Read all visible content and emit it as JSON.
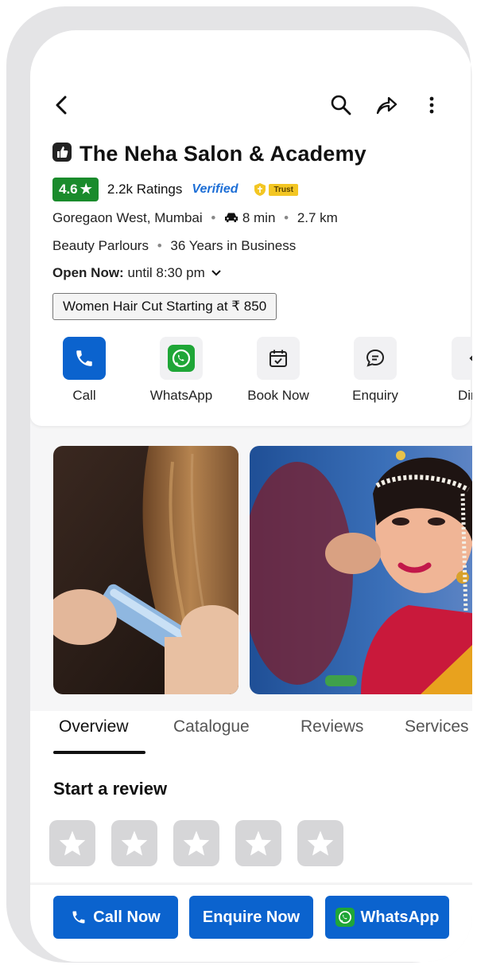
{
  "header": {
    "icons": [
      "back-arrow-icon",
      "search-icon",
      "share-icon",
      "more-vertical-icon"
    ]
  },
  "business": {
    "name": "The Neha Salon & Academy",
    "rating": "4.6",
    "rating_star": "★",
    "ratings_count": "2.2k Ratings",
    "verified_label": "Verified",
    "trust_label": "Trust",
    "location": "Goregaon West, Mumbai",
    "drive_time": "8 min",
    "distance": "2.7 km",
    "category": "Beauty Parlours",
    "years_in_business": "36 Years in Business",
    "open_label": "Open Now:",
    "open_until": "until 8:30 pm",
    "offer": "Women Hair Cut Starting at ₹ 850"
  },
  "actions": [
    {
      "label": "Call",
      "icon": "phone-icon"
    },
    {
      "label": "WhatsApp",
      "icon": "whatsapp-icon"
    },
    {
      "label": "Book Now",
      "icon": "calendar-check-icon"
    },
    {
      "label": "Enquiry",
      "icon": "chat-bubble-icon"
    },
    {
      "label": "Dire",
      "icon": "directions-icon"
    }
  ],
  "tabs": [
    {
      "label": "Overview",
      "active": true
    },
    {
      "label": "Catalogue"
    },
    {
      "label": "Reviews"
    },
    {
      "label": "Services"
    }
  ],
  "review": {
    "title": "Start a review",
    "star_count": 5
  },
  "bottom_bar": {
    "call_label": "Call Now",
    "enquire_label": "Enquire Now",
    "whatsapp_label": "WhatsApp"
  },
  "colors": {
    "primary_blue": "#0b63ce",
    "rating_green": "#1a8b2c",
    "whatsapp_green": "#1fa637",
    "verified_blue": "#1e6fd6",
    "trust_yellow": "#f3c623"
  }
}
